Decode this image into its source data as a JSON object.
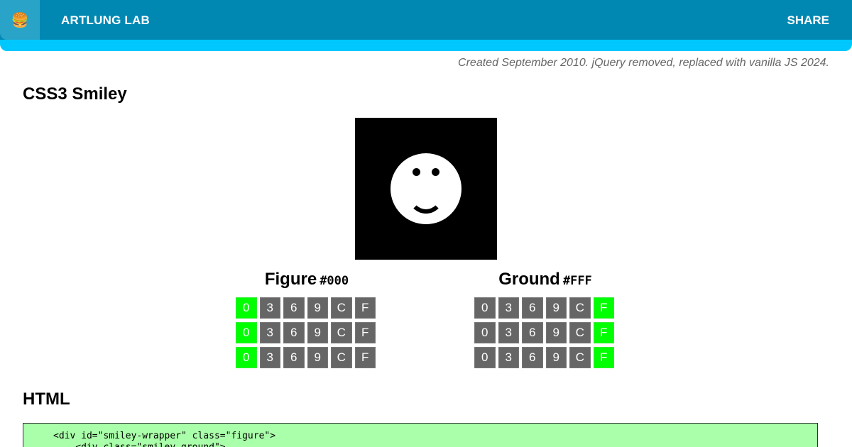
{
  "header": {
    "logo_icon": "🍔",
    "site_title": "ARTLUNG LAB",
    "share_label": "SHARE"
  },
  "meta": {
    "created": "Created September 2010. jQuery removed, replaced with vanilla JS 2024."
  },
  "page_title": "CSS3 Smiley",
  "figure": {
    "label": "Figure",
    "hex": "#000",
    "options": [
      "0",
      "3",
      "6",
      "9",
      "C",
      "F"
    ],
    "selected": [
      "0",
      "0",
      "0"
    ]
  },
  "ground": {
    "label": "Ground",
    "hex": "#FFF",
    "options": [
      "0",
      "3",
      "6",
      "9",
      "C",
      "F"
    ],
    "selected": [
      "F",
      "F",
      "F"
    ]
  },
  "html_section": {
    "title": "HTML",
    "code_lines": [
      "<div id=\"smiley-wrapper\" class=\"figure\">",
      "    <div class=\"smiley ground\">"
    ]
  },
  "colors": {
    "header_bar": "#0088b3",
    "header_accent": "#00c8ff",
    "active_cell": "#00ff00",
    "cell": "#666666",
    "code_bg": "#aaffaa"
  }
}
